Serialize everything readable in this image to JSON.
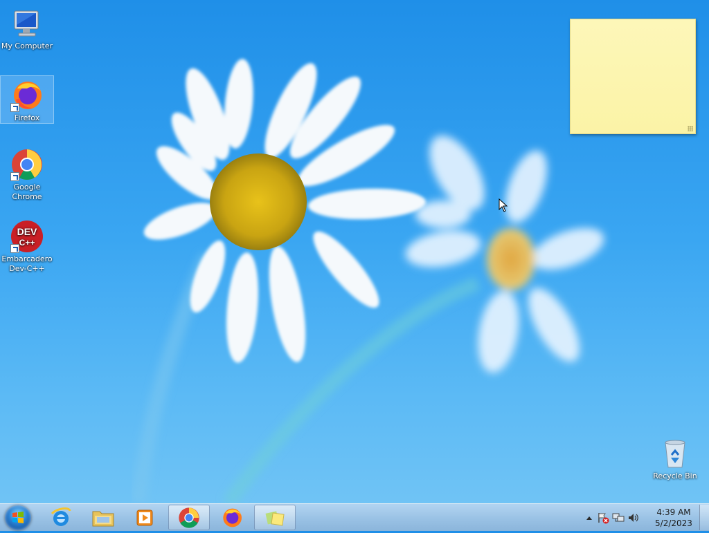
{
  "desktop": {
    "icons": [
      {
        "label": "My Computer",
        "icon": "computer-icon"
      },
      {
        "label": "Firefox",
        "icon": "firefox-icon"
      },
      {
        "label": "Google Chrome",
        "icon": "chrome-icon"
      },
      {
        "label": "Embarcadero Dev-C++",
        "icon": "devcpp-icon"
      },
      {
        "label": "Recycle Bin",
        "icon": "recycle-bin-icon"
      }
    ],
    "devcpp_badge": "DEV",
    "devcpp_badge2": "C++"
  },
  "sticky_note": {
    "text": ""
  },
  "taskbar": {
    "pinned": [
      {
        "name": "internet-explorer",
        "icon": "ie-icon"
      },
      {
        "name": "file-explorer",
        "icon": "folder-icon"
      },
      {
        "name": "media-player",
        "icon": "media-player-icon"
      },
      {
        "name": "google-chrome",
        "icon": "chrome-icon"
      },
      {
        "name": "firefox",
        "icon": "firefox-icon"
      },
      {
        "name": "sticky-notes",
        "icon": "sticky-notes-icon"
      }
    ],
    "clock": {
      "time": "4:39 AM",
      "date": "5/2/2023"
    }
  },
  "colors": {
    "wallpaper_blue": "#2e9cf0",
    "sticky_yellow": "#fdf7b9",
    "taskbar": "#a9c8e8"
  }
}
